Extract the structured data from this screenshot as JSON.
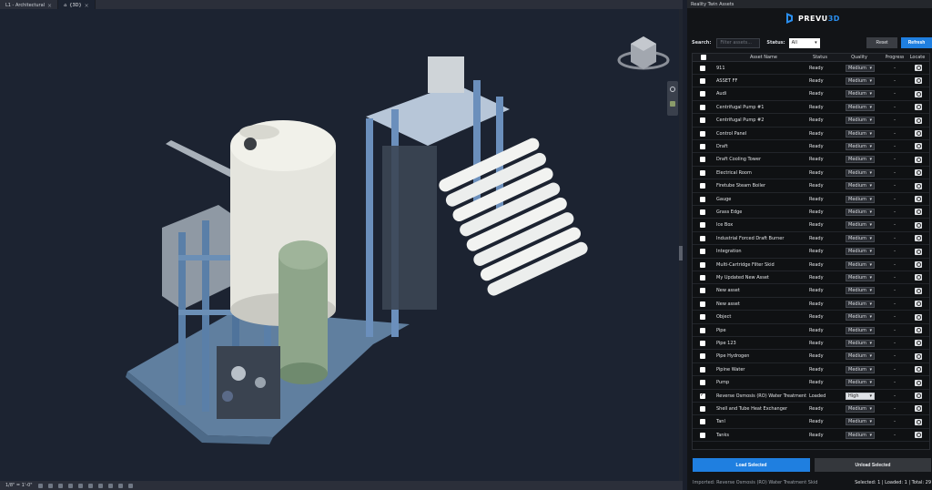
{
  "tabs": [
    {
      "label": "L1 - Architectural",
      "active": false
    },
    {
      "label": "{3D}",
      "active": true
    }
  ],
  "statusbar": {
    "scale": "1/8\" = 1'-0\""
  },
  "panel": {
    "title": "Reality Twin Assets",
    "logo_main": "PREVU",
    "logo_accent": "3D",
    "search_label": "Search:",
    "search_placeholder": "Filter assets...",
    "status_label": "Status:",
    "status_value": "All",
    "reset_label": "Reset",
    "refresh_label": "Refresh",
    "columns": [
      "Asset Name",
      "Status",
      "Quality",
      "Progress",
      "Locate"
    ],
    "rows": [
      {
        "name": "911",
        "status": "Ready",
        "quality": "Medium",
        "progress": "-",
        "checked": false
      },
      {
        "name": "ASSET FF",
        "status": "Ready",
        "quality": "Medium",
        "progress": "-",
        "checked": false
      },
      {
        "name": "Audi",
        "status": "Ready",
        "quality": "Medium",
        "progress": "-",
        "checked": false
      },
      {
        "name": "Centrifugal Pump #1",
        "status": "Ready",
        "quality": "Medium",
        "progress": "-",
        "checked": false
      },
      {
        "name": "Centrifugal Pump #2",
        "status": "Ready",
        "quality": "Medium",
        "progress": "-",
        "checked": false
      },
      {
        "name": "Control Panel",
        "status": "Ready",
        "quality": "Medium",
        "progress": "-",
        "checked": false
      },
      {
        "name": "Draft",
        "status": "Ready",
        "quality": "Medium",
        "progress": "-",
        "checked": false
      },
      {
        "name": "Draft Cooling Tower",
        "status": "Ready",
        "quality": "Medium",
        "progress": "-",
        "checked": false
      },
      {
        "name": "Electrical Room",
        "status": "Ready",
        "quality": "Medium",
        "progress": "-",
        "checked": false
      },
      {
        "name": "Firetube Steam Boiler",
        "status": "Ready",
        "quality": "Medium",
        "progress": "-",
        "checked": false
      },
      {
        "name": "Gauge",
        "status": "Ready",
        "quality": "Medium",
        "progress": "-",
        "checked": false
      },
      {
        "name": "Grass Edge",
        "status": "Ready",
        "quality": "Medium",
        "progress": "-",
        "checked": false
      },
      {
        "name": "Ice Box",
        "status": "Ready",
        "quality": "Medium",
        "progress": "-",
        "checked": false
      },
      {
        "name": "Industrial Forced Draft Burner",
        "status": "Ready",
        "quality": "Medium",
        "progress": "-",
        "checked": false
      },
      {
        "name": "Integration",
        "status": "Ready",
        "quality": "Medium",
        "progress": "-",
        "checked": false
      },
      {
        "name": "Multi-Cartridge Filter Skid",
        "status": "Ready",
        "quality": "Medium",
        "progress": "-",
        "checked": false
      },
      {
        "name": "My Updated New Asset",
        "status": "Ready",
        "quality": "Medium",
        "progress": "-",
        "checked": false
      },
      {
        "name": "New asset",
        "status": "Ready",
        "quality": "Medium",
        "progress": "-",
        "checked": false
      },
      {
        "name": "New asset",
        "status": "Ready",
        "quality": "Medium",
        "progress": "-",
        "checked": false
      },
      {
        "name": "Object",
        "status": "Ready",
        "quality": "Medium",
        "progress": "-",
        "checked": false
      },
      {
        "name": "Pipe",
        "status": "Ready",
        "quality": "Medium",
        "progress": "-",
        "checked": false
      },
      {
        "name": "Pipe 123",
        "status": "Ready",
        "quality": "Medium",
        "progress": "-",
        "checked": false
      },
      {
        "name": "Pipe Hydrogen",
        "status": "Ready",
        "quality": "Medium",
        "progress": "-",
        "checked": false
      },
      {
        "name": "Pipine Water",
        "status": "Ready",
        "quality": "Medium",
        "progress": "-",
        "checked": false
      },
      {
        "name": "Pump",
        "status": "Ready",
        "quality": "Medium",
        "progress": "-",
        "checked": false
      },
      {
        "name": "Reverse Osmosis (RO) Water Treatment",
        "status": "Loaded",
        "quality": "High",
        "progress": "-",
        "checked": true
      },
      {
        "name": "Shell and Tube Heat Exchanger",
        "status": "Ready",
        "quality": "Medium",
        "progress": "-",
        "checked": false
      },
      {
        "name": "Tanl",
        "status": "Ready",
        "quality": "Medium",
        "progress": "-",
        "checked": false
      },
      {
        "name": "Tanks",
        "status": "Ready",
        "quality": "Medium",
        "progress": "-",
        "checked": false
      }
    ],
    "load_label": "Load Selected",
    "unload_label": "Unload Selected",
    "footer_status": "Imported: Reverse Osmosis (RO) Water Treatment Skid",
    "footer_counts": "Selected: 1 | Loaded: 1 | Total: 29"
  }
}
